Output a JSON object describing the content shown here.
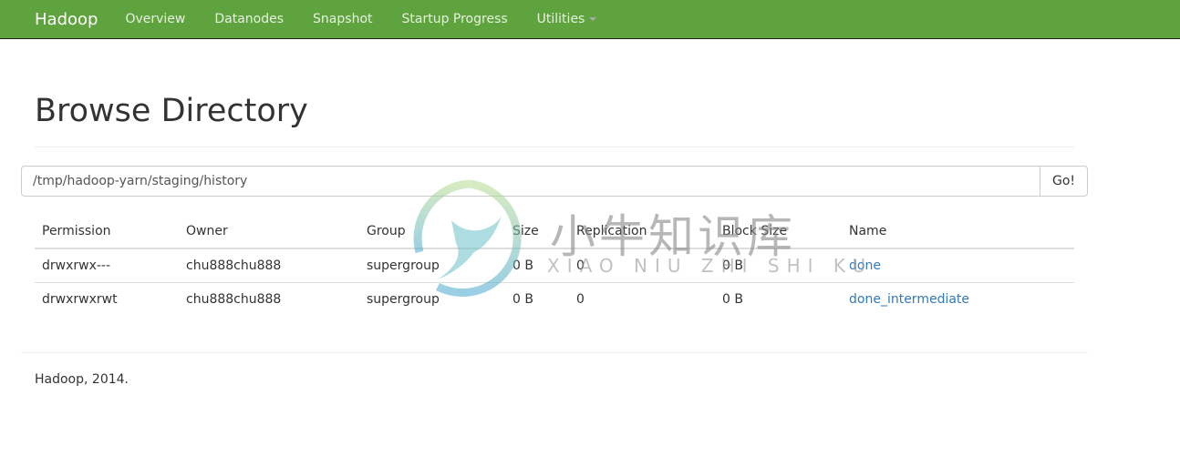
{
  "nav": {
    "brand": "Hadoop",
    "items": [
      "Overview",
      "Datanodes",
      "Snapshot",
      "Startup Progress",
      "Utilities"
    ],
    "color": "#5fa33e"
  },
  "page": {
    "title": "Browse Directory"
  },
  "path": {
    "value": "/tmp/hadoop-yarn/staging/history",
    "go": "Go!"
  },
  "table": {
    "headers": [
      "Permission",
      "Owner",
      "Group",
      "Size",
      "Replication",
      "Block Size",
      "Name"
    ],
    "rows": [
      [
        "drwxrwx---",
        "chu888chu888",
        "supergroup",
        "0 B",
        "0",
        "0 B",
        "done"
      ],
      [
        "drwxrwxrwt",
        "chu888chu888",
        "supergroup",
        "0 B",
        "0",
        "0 B",
        "done_intermediate"
      ]
    ]
  },
  "footer": "Hadoop, 2014.",
  "watermark": {
    "cn": "小牛知识库",
    "pinyin": "XIAO NIU ZHI SHI KU"
  }
}
